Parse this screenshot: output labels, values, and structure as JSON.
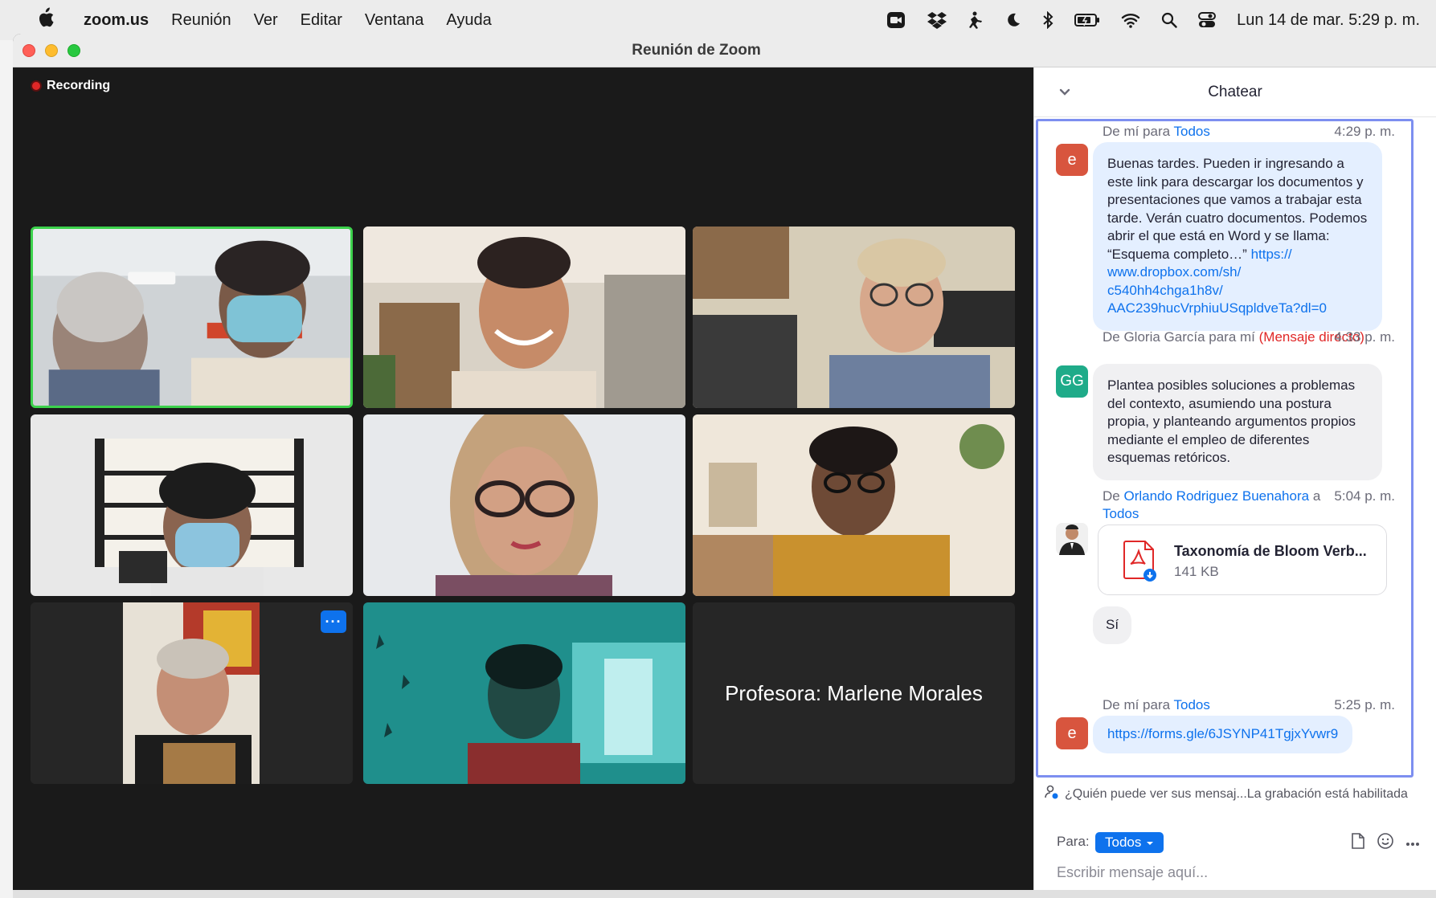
{
  "menubar": {
    "apple_icon": "apple-icon",
    "app_name": "zoom.us",
    "items": [
      "Reunión",
      "Ver",
      "Editar",
      "Ventana",
      "Ayuda"
    ],
    "clock": "Lun 14 de mar.  5:29 p. m."
  },
  "window": {
    "title": "Reunión de Zoom"
  },
  "video": {
    "recording_label": "Recording",
    "name_card": "Profesora: Marlene Morales",
    "more_label": "···"
  },
  "chat": {
    "title": "Chatear",
    "messages": [
      {
        "from": "De mí para",
        "to": "Todos",
        "time": "4:29 p. m.",
        "avatar": "e",
        "text": "Buenas tardes. Pueden ir ingresando a este link para descargar los documentos y presentaciones que vamos a trabajar esta tarde. Verán cuatro documentos. Podemos abrir el que está en Word y se llama: “Esquema completo…”",
        "link": "https://www.dropbox.com/sh/c540hh4chga1h8v/AAC239hucVrphiuUSqpldveTa?dl=0",
        "link_lines": [
          "https://",
          "www.dropbox.com/sh/",
          "c540hh4chga1h8v/",
          "AAC239hucVrphiuUSqpldveTa?dl=0"
        ]
      },
      {
        "from": "De Gloria García para mí",
        "tag": "(Mensaje directo)",
        "time": "4:33 p. m.",
        "avatar": "GG",
        "text": "Plantea posibles soluciones a problemas del contexto, asumiendo una postura propia, y planteando argumentos propios mediante el empleo de diferentes esquemas retóricos."
      },
      {
        "from_prefix": "De",
        "sender": "Orlando Rodriguez Buenahora",
        "to_prefix": "a",
        "to": "Todos",
        "time": "5:04 p. m.",
        "file_name": "Taxonomía de Bloom Verb...",
        "file_size": "141 KB",
        "reply": "Sí"
      },
      {
        "from": "De mí para",
        "to": "Todos",
        "time": "5:25 p. m.",
        "avatar": "e",
        "link": "https://forms.gle/6JSYNP41TgjxYvwr9"
      }
    ],
    "notice": "¿Quién puede ver sus mensaj...La grabación está habilitada",
    "to_label": "Para:",
    "to_value": "Todos",
    "input_placeholder": "Escribir mensaje aquí..."
  }
}
